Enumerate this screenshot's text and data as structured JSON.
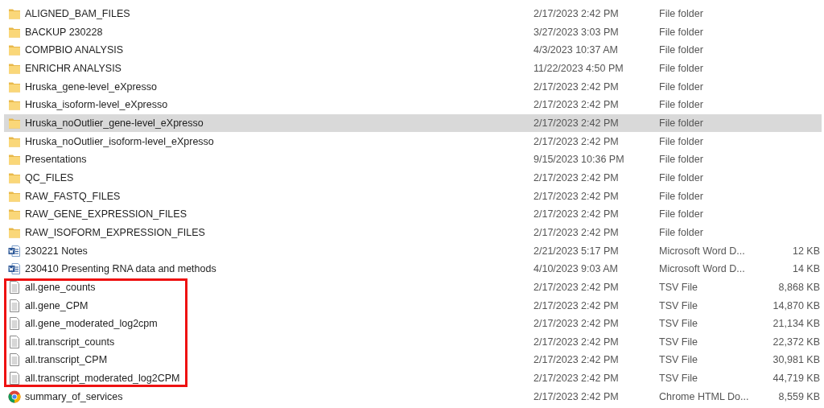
{
  "files": [
    {
      "name": "ALIGNED_BAM_FILES",
      "kind": "folder",
      "date": "2/17/2023 2:42 PM",
      "type": "File folder",
      "selected": false,
      "boxed": false
    },
    {
      "name": "BACKUP 230228",
      "kind": "folder",
      "date": "3/27/2023 3:03 PM",
      "type": "File folder",
      "selected": false,
      "boxed": false
    },
    {
      "name": "COMPBIO ANALYSIS",
      "kind": "folder",
      "date": "4/3/2023 10:37 AM",
      "type": "File folder",
      "selected": false,
      "boxed": false
    },
    {
      "name": "ENRICHR ANALYSIS",
      "kind": "folder",
      "date": "11/22/2023 4:50 PM",
      "type": "File folder",
      "selected": false,
      "boxed": false
    },
    {
      "name": "Hruska_gene-level_eXpresso",
      "kind": "folder",
      "date": "2/17/2023 2:42 PM",
      "type": "File folder",
      "selected": false,
      "boxed": false
    },
    {
      "name": "Hruska_isoform-level_eXpresso",
      "kind": "folder",
      "date": "2/17/2023 2:42 PM",
      "type": "File folder",
      "selected": false,
      "boxed": false
    },
    {
      "name": "Hruska_noOutlier_gene-level_eXpresso",
      "kind": "folder",
      "date": "2/17/2023 2:42 PM",
      "type": "File folder",
      "selected": true,
      "boxed": false
    },
    {
      "name": "Hruska_noOutlier_isoform-level_eXpresso",
      "kind": "folder",
      "date": "2/17/2023 2:42 PM",
      "type": "File folder",
      "selected": false,
      "boxed": false
    },
    {
      "name": "Presentations",
      "kind": "folder",
      "date": "9/15/2023 10:36 PM",
      "type": "File folder",
      "selected": false,
      "boxed": false
    },
    {
      "name": "QC_FILES",
      "kind": "folder",
      "date": "2/17/2023 2:42 PM",
      "type": "File folder",
      "selected": false,
      "boxed": false
    },
    {
      "name": "RAW_FASTQ_FILES",
      "kind": "folder",
      "date": "2/17/2023 2:42 PM",
      "type": "File folder",
      "selected": false,
      "boxed": false
    },
    {
      "name": "RAW_GENE_EXPRESSION_FILES",
      "kind": "folder",
      "date": "2/17/2023 2:42 PM",
      "type": "File folder",
      "selected": false,
      "boxed": false
    },
    {
      "name": "RAW_ISOFORM_EXPRESSION_FILES",
      "kind": "folder",
      "date": "2/17/2023 2:42 PM",
      "type": "File folder",
      "selected": false,
      "boxed": false
    },
    {
      "name": "230221 Notes",
      "kind": "word",
      "date": "2/21/2023 5:17 PM",
      "type": "Microsoft Word D...",
      "size": "12 KB",
      "selected": false,
      "boxed": false
    },
    {
      "name": "230410 Presenting RNA data and methods",
      "kind": "word",
      "date": "4/10/2023 9:03 AM",
      "type": "Microsoft Word D...",
      "size": "14 KB",
      "selected": false,
      "boxed": false
    },
    {
      "name": "all.gene_counts",
      "kind": "text",
      "date": "2/17/2023 2:42 PM",
      "type": "TSV File",
      "size": "8,868 KB",
      "selected": false,
      "boxed": true
    },
    {
      "name": "all.gene_CPM",
      "kind": "text",
      "date": "2/17/2023 2:42 PM",
      "type": "TSV File",
      "size": "14,870 KB",
      "selected": false,
      "boxed": true
    },
    {
      "name": "all.gene_moderated_log2cpm",
      "kind": "text",
      "date": "2/17/2023 2:42 PM",
      "type": "TSV File",
      "size": "21,134 KB",
      "selected": false,
      "boxed": true
    },
    {
      "name": "all.transcript_counts",
      "kind": "text",
      "date": "2/17/2023 2:42 PM",
      "type": "TSV File",
      "size": "22,372 KB",
      "selected": false,
      "boxed": true
    },
    {
      "name": "all.transcript_CPM",
      "kind": "text",
      "date": "2/17/2023 2:42 PM",
      "type": "TSV File",
      "size": "30,981 KB",
      "selected": false,
      "boxed": true
    },
    {
      "name": "all.transcript_moderated_log2CPM",
      "kind": "text",
      "date": "2/17/2023 2:42 PM",
      "type": "TSV File",
      "size": "44,719 KB",
      "selected": false,
      "boxed": true
    },
    {
      "name": "summary_of_services",
      "kind": "chrome",
      "date": "2/17/2023 2:42 PM",
      "type": "Chrome HTML Do...",
      "size": "8,559 KB",
      "selected": false,
      "boxed": false
    }
  ]
}
